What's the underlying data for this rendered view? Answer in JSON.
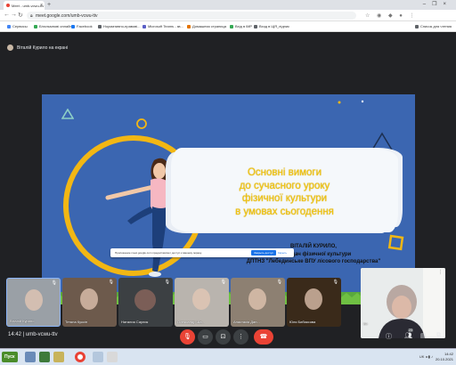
{
  "browser": {
    "tab_title": "Meet - umb-vcwu-ttv",
    "url": "meet.google.com/umb-vcwu-ttv",
    "bookmarks": [
      {
        "label": "Сервисы",
        "color": "#4285f4"
      },
      {
        "label": "Бітальмнові онлайн",
        "color": "#34a853"
      },
      {
        "label": "Facebook",
        "color": "#1877f2"
      },
      {
        "label": "Нормативно-правові...",
        "color": "#5f6368"
      },
      {
        "label": "Microsoft Teams - зв...",
        "color": "#5b5fc7"
      },
      {
        "label": "Домашняя страница",
        "color": "#e37400"
      },
      {
        "label": "Вхід в iMP",
        "color": "#34a853"
      },
      {
        "label": "Вход в ЩЯ_підпис",
        "color": "#5f6368"
      },
      {
        "label": "Список для чтения",
        "color": "#5f6368"
      }
    ]
  },
  "meet": {
    "presenter_label": "Віталій Курило на екрані",
    "slide": {
      "title_lines": [
        "Основні вимоги",
        "до сучасного уроку",
        "фізичної культури",
        "в умовах сьогодення"
      ],
      "author_name": "ВІТАЛІЙ КУРИЛО,",
      "author_role": "викладач фізичної культури",
      "author_org": "ДПТНЗ \"Лебединське ВПУ лісового господарства\""
    },
    "share_notice": {
      "text": "Приложение meet.google.com предоставляет доступ к вашему экрану.",
      "stop_label": "Закрыть доступ",
      "hide_label": "Скрыть"
    },
    "participants": [
      {
        "name": "Віталій Курило",
        "type": "video",
        "color": "#9aa0a6"
      },
      {
        "name": "Тетяна Куксін",
        "type": "video",
        "color": "#6d5a4c"
      },
      {
        "name": "Наталия Саулик",
        "type": "avatar",
        "initial": "",
        "color": "#5f6368"
      },
      {
        "name": "Олександр Ша...",
        "type": "video",
        "color": "#b9b4ae"
      },
      {
        "name": "Анастасія Дан...",
        "type": "video",
        "color": "#8d8072"
      },
      {
        "name": "Юля Бибиксова",
        "type": "video",
        "color": "#3a2a1a"
      },
      {
        "name": "Ви",
        "type": "video",
        "color": "#c9ccce"
      }
    ],
    "controls": {
      "time": "14:42",
      "meeting_code": "umb-vcwu-ttv",
      "participant_count": "23"
    }
  },
  "taskbar": {
    "start_label": "Пуск",
    "tray_lang": "UK",
    "time": "14:42",
    "date": "20.10.2021"
  }
}
